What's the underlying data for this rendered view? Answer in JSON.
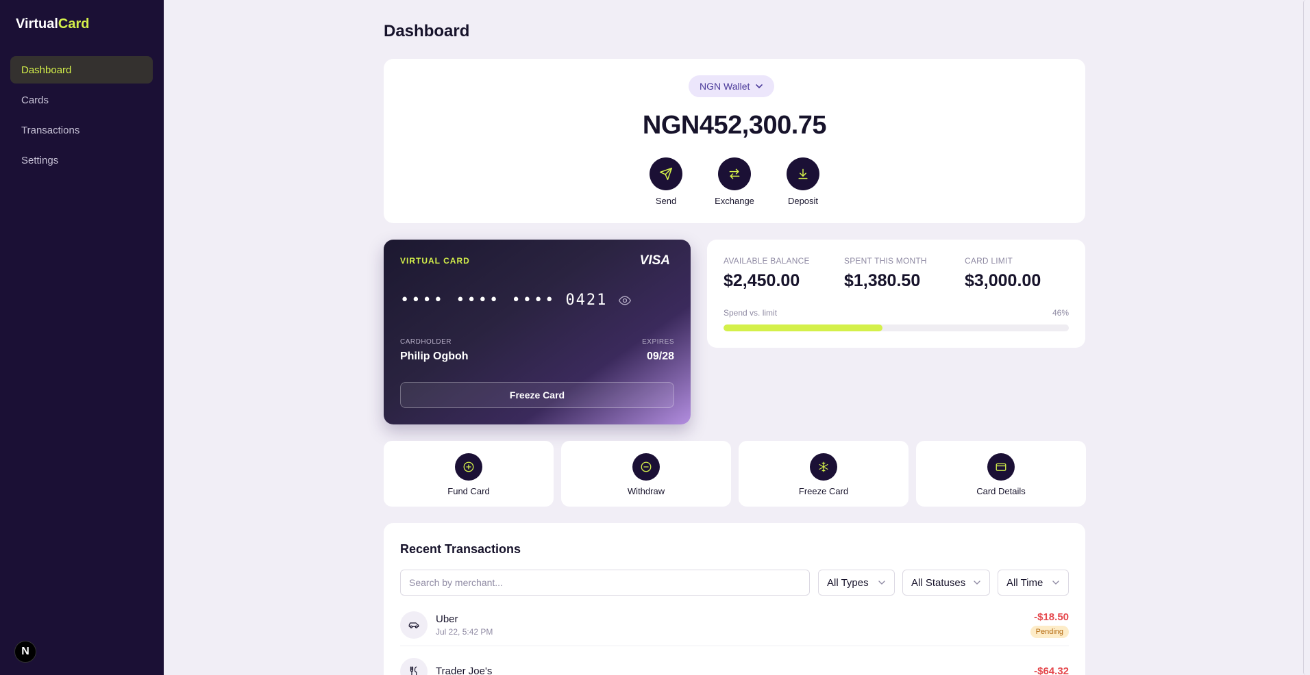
{
  "brand": {
    "part1": "Virtual",
    "part2": "Card"
  },
  "sidebar": {
    "items": [
      {
        "label": "Dashboard",
        "active": true
      },
      {
        "label": "Cards",
        "active": false
      },
      {
        "label": "Transactions",
        "active": false
      },
      {
        "label": "Settings",
        "active": false
      }
    ],
    "badge": "N"
  },
  "page": {
    "title": "Dashboard"
  },
  "wallet": {
    "selector_label": "NGN Wallet",
    "balance": "NGN452,300.75",
    "actions": [
      {
        "label": "Send",
        "icon": "send-icon"
      },
      {
        "label": "Exchange",
        "icon": "exchange-icon"
      },
      {
        "label": "Deposit",
        "icon": "deposit-icon"
      }
    ]
  },
  "virtual_card": {
    "label": "VIRTUAL CARD",
    "network": "VISA",
    "masked": "•••• •••• ••••",
    "last4": "0421",
    "holder_label": "CARDHOLDER",
    "holder": "Philip Ogboh",
    "expires_label": "EXPIRES",
    "expires": "09/28",
    "freeze_label": "Freeze Card"
  },
  "stats": {
    "available_label": "AVAILABLE BALANCE",
    "available": "$2,450.00",
    "spent_label": "SPENT THIS MONTH",
    "spent": "$1,380.50",
    "limit_label": "CARD LIMIT",
    "limit": "$3,000.00",
    "spend_label": "Spend vs. limit",
    "spend_pct_label": "46%",
    "spend_fraction": 0.46
  },
  "quick_actions": [
    {
      "label": "Fund Card",
      "icon": "plus-circle-icon"
    },
    {
      "label": "Withdraw",
      "icon": "minus-circle-icon"
    },
    {
      "label": "Freeze Card",
      "icon": "snowflake-icon"
    },
    {
      "label": "Card Details",
      "icon": "credit-card-icon"
    }
  ],
  "transactions": {
    "title": "Recent Transactions",
    "search_placeholder": "Search by merchant...",
    "filters": {
      "type": "All Types",
      "status": "All Statuses",
      "time": "All Time"
    },
    "rows": [
      {
        "merchant": "Uber",
        "date": "Jul 22, 5:42 PM",
        "amount": "-$18.50",
        "status": "Pending",
        "icon": "car-icon"
      },
      {
        "merchant": "Trader Joe's",
        "date": "",
        "amount": "-$64.32",
        "status": "",
        "icon": "utensils-icon"
      }
    ]
  },
  "colors": {
    "accent": "#d4f04a",
    "sidebar": "#1b1035",
    "negative": "#e5484d"
  }
}
